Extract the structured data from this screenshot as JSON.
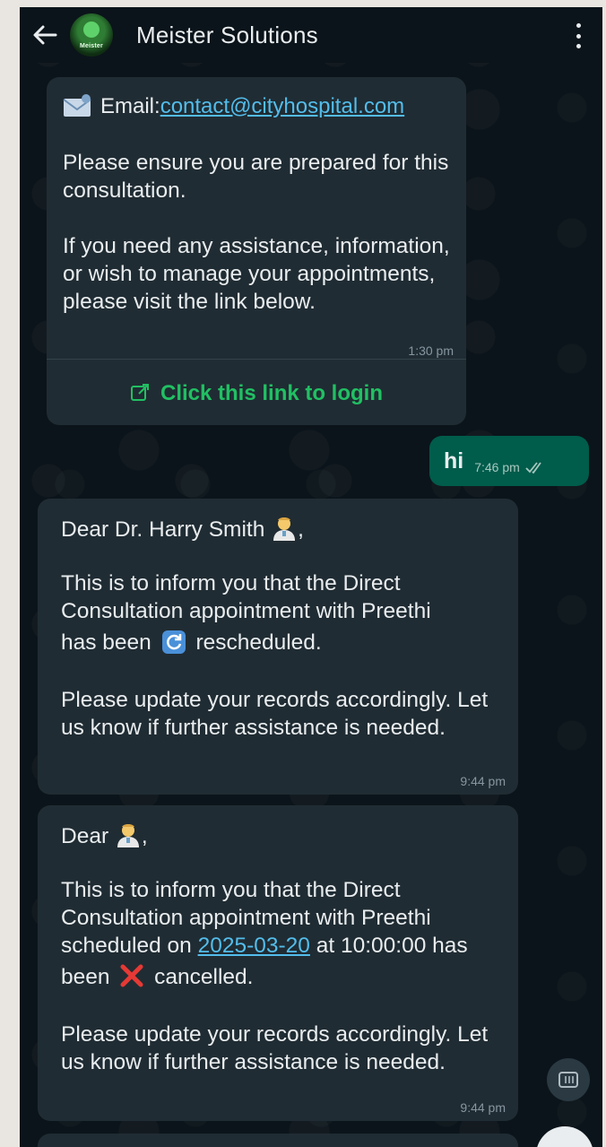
{
  "header": {
    "title": "Meister Solutions",
    "avatar_label": "Meister"
  },
  "messages": [
    {
      "email_label": "Email: ",
      "email": "contact@cityhospital.com",
      "para1": "Please ensure you are prepared for this consultation.",
      "para2": "If you need any assistance, information, or wish to manage your appointments, please visit the link below.",
      "time": "1:30 pm",
      "cta": "Click this link to login"
    },
    {
      "text": "hi",
      "time": "7:46 pm"
    },
    {
      "greeting": "Dear Dr. Harry Smith",
      "greeting_suffix": ",",
      "line1": "This is to inform you that the Direct Consultation appointment with Preethi",
      "line2_pre": "has been",
      "line2_post": "rescheduled.",
      "para2": "Please update your records accordingly. Let us know if further assistance is needed.",
      "time": "9:44 pm"
    },
    {
      "greeting": "Dear",
      "greeting_suffix": ",",
      "line1": "This is to inform you that the Direct Consultation appointment with Preethi scheduled on",
      "date": "2025-03-20",
      "line1b": "at 10:00:00 has",
      "line2_pre": "been",
      "line2_post": "cancelled.",
      "para2": "Please update your records accordingly. Let us know if further assistance is needed.",
      "time": "9:44 pm"
    }
  ],
  "colors": {
    "background": "#0b141a",
    "bubble_in": "#202c33",
    "bubble_out": "#005c4b",
    "link": "#53bdeb",
    "cta": "#21c063"
  }
}
